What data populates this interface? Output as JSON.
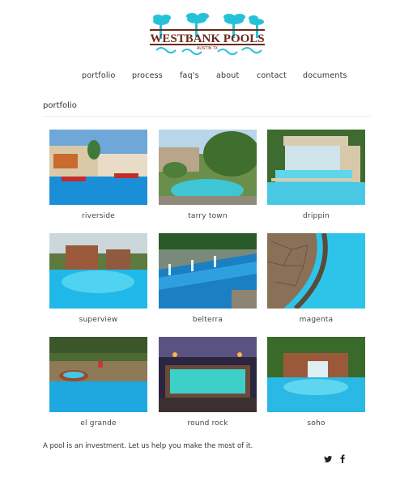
{
  "brand": {
    "name": "WESTBANK POOLS",
    "subtitle": "AUSTIN TX",
    "accent_teal": "#25c1d9",
    "accent_brown": "#6b2a1c"
  },
  "nav": {
    "items": [
      {
        "label": "portfolio"
      },
      {
        "label": "process"
      },
      {
        "label": "faq's"
      },
      {
        "label": "about"
      },
      {
        "label": "contact"
      },
      {
        "label": "documents"
      }
    ]
  },
  "page": {
    "title": "portfolio"
  },
  "portfolio": {
    "items": [
      {
        "caption": "riverside",
        "image": "pool-photo-riverside"
      },
      {
        "caption": "tarry town",
        "image": "pool-photo-tarry-town"
      },
      {
        "caption": "drippin",
        "image": "pool-photo-drippin"
      },
      {
        "caption": "superview",
        "image": "pool-photo-superview"
      },
      {
        "caption": "belterra",
        "image": "pool-photo-belterra"
      },
      {
        "caption": "magenta",
        "image": "pool-photo-magenta"
      },
      {
        "caption": "el grande",
        "image": "pool-photo-el-grande"
      },
      {
        "caption": "round rock",
        "image": "pool-photo-round-rock"
      },
      {
        "caption": "soho",
        "image": "pool-photo-soho"
      }
    ]
  },
  "footer": {
    "tagline": "A pool is an investment. Let us help you make the most of it.",
    "social": [
      {
        "icon": "twitter-icon"
      },
      {
        "icon": "facebook-icon"
      }
    ]
  }
}
